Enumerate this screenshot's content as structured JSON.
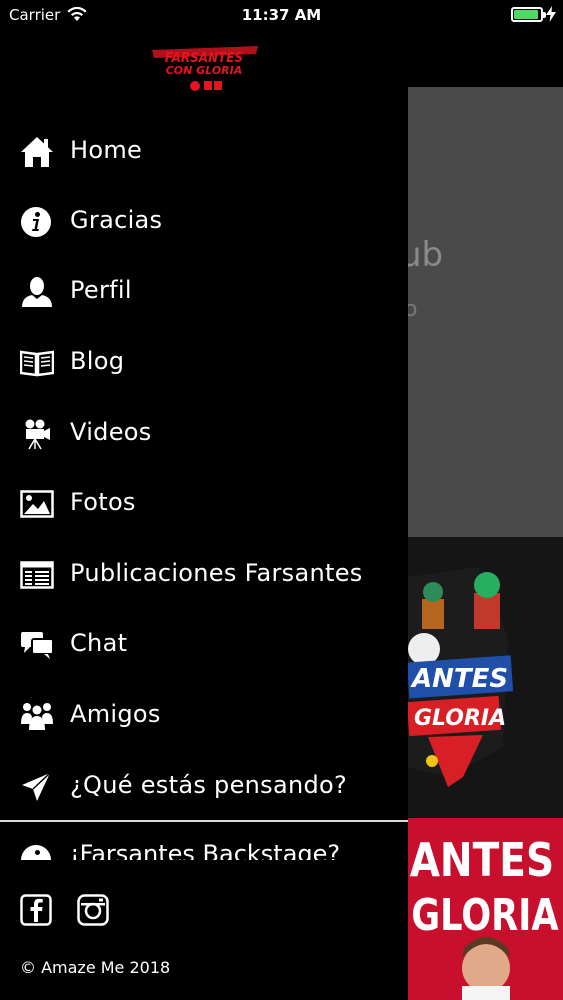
{
  "status_bar": {
    "carrier": "Carrier",
    "time": "11:37 AM"
  },
  "drawer": {
    "logo_text": "FARSANTES CON GLORIA",
    "menu": [
      {
        "label": "Home",
        "icon": "home-icon"
      },
      {
        "label": "Gracias",
        "icon": "info-icon"
      },
      {
        "label": "Perfil",
        "icon": "user-icon"
      },
      {
        "label": "Blog",
        "icon": "book-icon"
      },
      {
        "label": "Videos",
        "icon": "video-camera-icon"
      },
      {
        "label": "Fotos",
        "icon": "photo-icon"
      },
      {
        "label": "Publicaciones Farsantes",
        "icon": "newspaper-icon"
      },
      {
        "label": "Chat",
        "icon": "chat-icon"
      },
      {
        "label": "Amigos",
        "icon": "friends-icon"
      },
      {
        "label": "¿Qué estás pensando?",
        "icon": "paper-plane-icon"
      }
    ],
    "partial_item": {
      "label": "¡Farsantes Backstage?",
      "icon": "info-icon"
    },
    "social": [
      {
        "icon": "facebook-icon"
      },
      {
        "icon": "instagram-icon"
      }
    ],
    "copyright": "© Amaze  Me 2018"
  },
  "background": {
    "gray_panel_text_1": "ub",
    "gray_panel_text_2": "o",
    "banner_1_text": "ANTES GLORIA",
    "banner_2_text": "ANTES GLORIA"
  }
}
